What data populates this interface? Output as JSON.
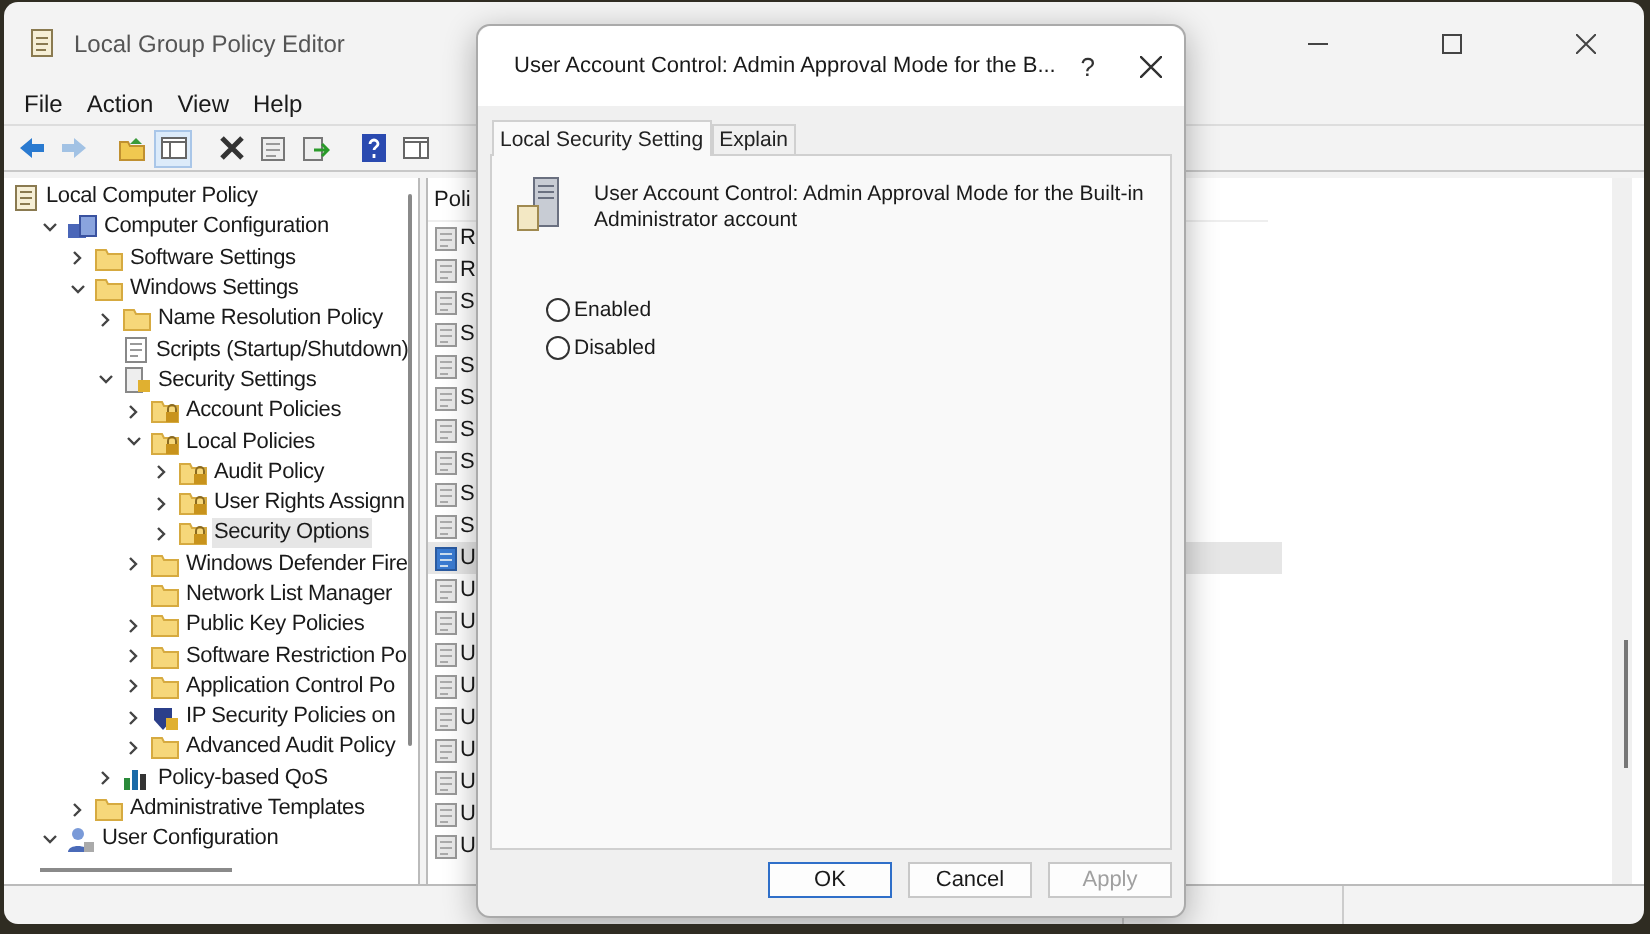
{
  "window": {
    "title": "Local Group Policy Editor"
  },
  "menu": [
    "File",
    "Action",
    "View",
    "Help"
  ],
  "toolbar": [
    {
      "kind": "back",
      "disabled": false,
      "pressed": false
    },
    {
      "kind": "forward",
      "disabled": true,
      "pressed": false
    },
    {
      "kind": "up",
      "disabled": false,
      "pressed": false
    },
    {
      "kind": "tree",
      "disabled": false,
      "pressed": true
    },
    {
      "kind": "delete",
      "disabled": false,
      "pressed": false
    },
    {
      "kind": "properties",
      "disabled": false,
      "pressed": false
    },
    {
      "kind": "export",
      "disabled": false,
      "pressed": false
    },
    {
      "kind": "help",
      "disabled": false,
      "pressed": false
    },
    {
      "kind": "console",
      "disabled": false,
      "pressed": false
    }
  ],
  "tree": [
    {
      "label": "Local Computer Policy",
      "kind": "policy",
      "selected": false,
      "children": [
        {
          "label": "Computer Configuration",
          "kind": "computer",
          "expanded": true,
          "selected": false,
          "children": [
            {
              "label": "Software Settings",
              "kind": "folder",
              "expanded": false,
              "selected": false
            },
            {
              "label": "Windows Settings",
              "kind": "folder",
              "expanded": true,
              "selected": false,
              "children": [
                {
                  "label": "Name Resolution Policy",
                  "kind": "folder",
                  "expanded": false,
                  "selected": false
                },
                {
                  "label": "Scripts (Startup/Shutdown)",
                  "kind": "script",
                  "selected": false
                },
                {
                  "label": "Security Settings",
                  "kind": "security",
                  "expanded": true,
                  "selected": false,
                  "children": [
                    {
                      "label": "Account Policies",
                      "kind": "locked",
                      "expanded": false,
                      "selected": false
                    },
                    {
                      "label": "Local Policies",
                      "kind": "locked",
                      "expanded": true,
                      "selected": false,
                      "children": [
                        {
                          "label": "Audit Policy",
                          "kind": "locked",
                          "expanded": false,
                          "selected": false
                        },
                        {
                          "label": "User Rights Assignn",
                          "kind": "locked",
                          "expanded": false,
                          "selected": false
                        },
                        {
                          "label": "Security Options",
                          "kind": "locked",
                          "expanded": false,
                          "selected": true
                        }
                      ]
                    },
                    {
                      "label": "Windows Defender Fire",
                      "kind": "folder",
                      "expanded": false,
                      "selected": false
                    },
                    {
                      "label": "Network List Manager",
                      "kind": "folder",
                      "selected": false
                    },
                    {
                      "label": "Public Key Policies",
                      "kind": "folder",
                      "expanded": false,
                      "selected": false
                    },
                    {
                      "label": "Software Restriction Po",
                      "kind": "folder",
                      "expanded": false,
                      "selected": false
                    },
                    {
                      "label": "Application Control Po",
                      "kind": "folder",
                      "expanded": false,
                      "selected": false
                    },
                    {
                      "label": "IP Security Policies on",
                      "kind": "shield",
                      "expanded": false,
                      "selected": false
                    },
                    {
                      "label": "Advanced Audit Policy",
                      "kind": "folder",
                      "expanded": false,
                      "selected": false
                    }
                  ]
                },
                {
                  "label": "Policy-based QoS",
                  "kind": "chart",
                  "expanded": false,
                  "selected": false
                }
              ]
            },
            {
              "label": "Administrative Templates",
              "kind": "folder",
              "expanded": false,
              "selected": false
            }
          ]
        },
        {
          "label": "User Configuration",
          "kind": "user",
          "expanded": true,
          "selected": false
        }
      ]
    }
  ],
  "list": {
    "column_1": "Poli",
    "rows": [
      {
        "text": "R",
        "selected": false
      },
      {
        "text": "R",
        "selected": false
      },
      {
        "text": "S",
        "selected": false
      },
      {
        "text": "S",
        "selected": false
      },
      {
        "text": "S",
        "selected": false
      },
      {
        "text": "S",
        "selected": false
      },
      {
        "text": "S",
        "selected": false
      },
      {
        "text": "S",
        "selected": false
      },
      {
        "text": "S",
        "selected": false
      },
      {
        "text": "S",
        "selected": false
      },
      {
        "text": "U",
        "selected": true
      },
      {
        "text": "U",
        "selected": false
      },
      {
        "text": "U",
        "selected": false
      },
      {
        "text": "U",
        "selected": false
      },
      {
        "text": "U",
        "selected": false
      },
      {
        "text": "U",
        "selected": false
      },
      {
        "text": "U",
        "selected": false
      },
      {
        "text": "U",
        "selected": false
      },
      {
        "text": "U",
        "selected": false
      },
      {
        "text": "U",
        "selected": false
      }
    ]
  },
  "dialog": {
    "title": "User Account Control: Admin Approval Mode for the B...",
    "help": "?",
    "tabs": [
      {
        "label": "Local Security Setting",
        "selected": true
      },
      {
        "label": "Explain",
        "selected": false
      }
    ],
    "policy_name": "User Account Control: Admin Approval Mode for the Built-in Administrator account",
    "options": [
      {
        "label": "Enabled",
        "selected": false
      },
      {
        "label": "Disabled",
        "selected": false
      }
    ],
    "buttons": [
      {
        "label": "OK",
        "kind": "default",
        "disabled": false
      },
      {
        "label": "Cancel",
        "kind": "normal",
        "disabled": false
      },
      {
        "label": "Apply",
        "kind": "normal",
        "disabled": true
      }
    ]
  }
}
